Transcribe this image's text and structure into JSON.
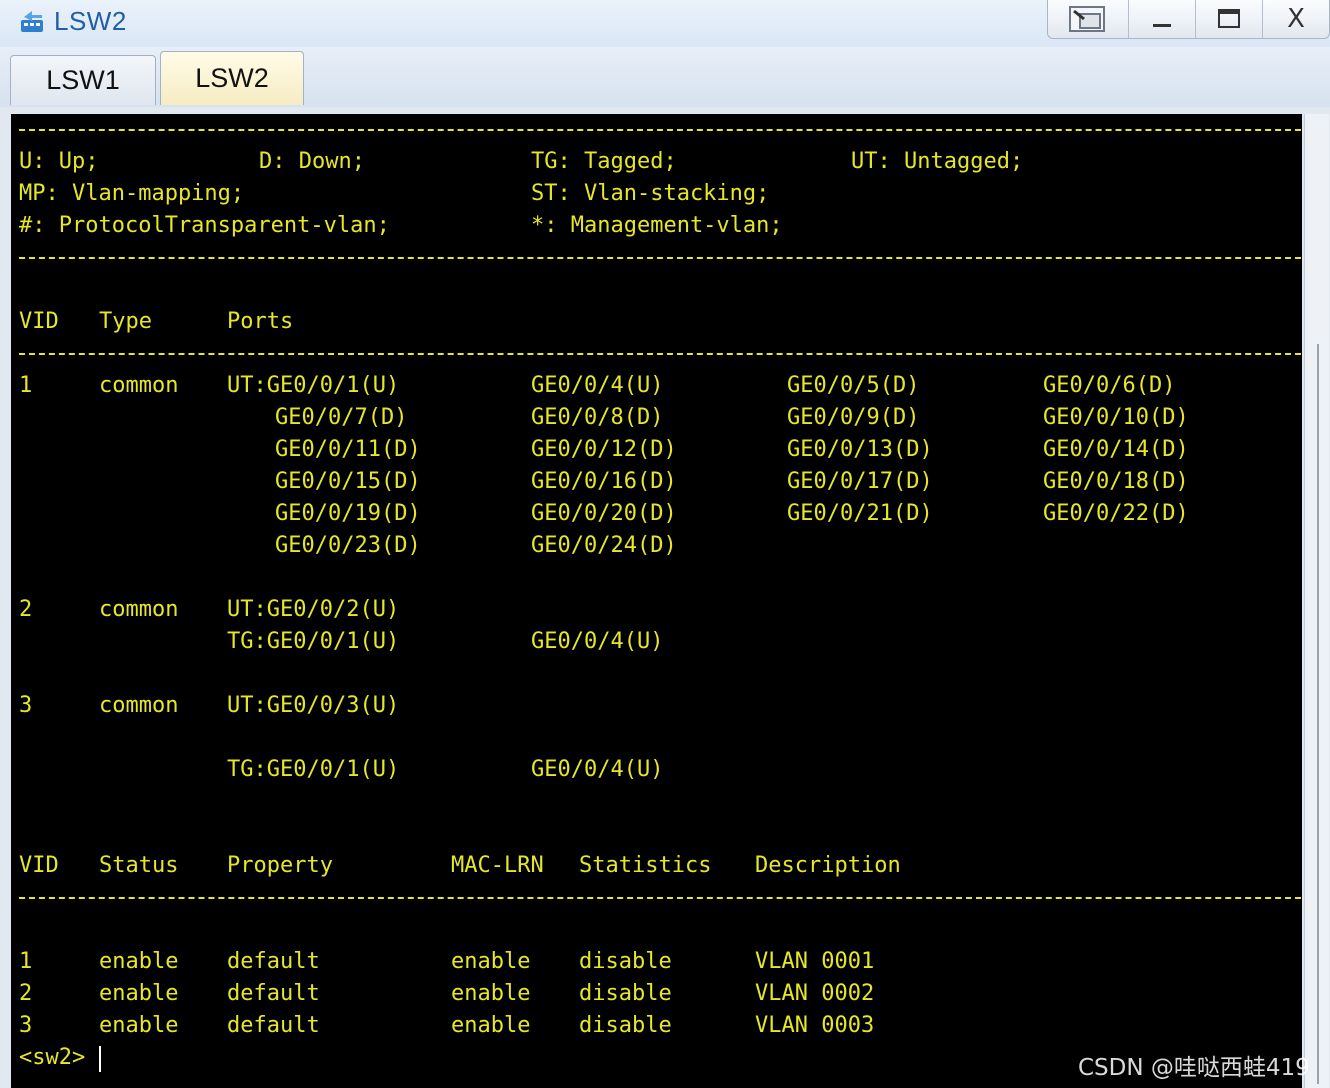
{
  "window": {
    "title": "LSW2",
    "icon": "switch-icon",
    "controls": [
      "restore-tab-icon",
      "minimize-icon",
      "maximize-icon",
      "close-icon"
    ],
    "close_glyph": "X"
  },
  "tabs": [
    {
      "label": "LSW1",
      "active": false
    },
    {
      "label": "LSW2",
      "active": true
    }
  ],
  "terminal": {
    "legend": {
      "up": "U: Up;",
      "down": "D: Down;",
      "tagged": "TG: Tagged;",
      "untagged": "UT: Untagged;",
      "mapping": "MP: Vlan-mapping;",
      "stacking": "ST: Vlan-stacking;",
      "transparent": "#: ProtocolTransparent-vlan;",
      "mgmt": "*: Management-vlan;"
    },
    "vlan_header": {
      "vid": "VID",
      "type": "Type",
      "ports": "Ports"
    },
    "vlan1": {
      "vid": "1",
      "type": "common",
      "rows": [
        [
          "UT:GE0/0/1(U)",
          "GE0/0/4(U)",
          "GE0/0/5(D)",
          "GE0/0/6(D)"
        ],
        [
          "GE0/0/7(D)",
          "GE0/0/8(D)",
          "GE0/0/9(D)",
          "GE0/0/10(D)"
        ],
        [
          "GE0/0/11(D)",
          "GE0/0/12(D)",
          "GE0/0/13(D)",
          "GE0/0/14(D)"
        ],
        [
          "GE0/0/15(D)",
          "GE0/0/16(D)",
          "GE0/0/17(D)",
          "GE0/0/18(D)"
        ],
        [
          "GE0/0/19(D)",
          "GE0/0/20(D)",
          "GE0/0/21(D)",
          "GE0/0/22(D)"
        ],
        [
          "GE0/0/23(D)",
          "GE0/0/24(D)"
        ]
      ]
    },
    "vlan2": {
      "vid": "2",
      "type": "common",
      "ut": "UT:GE0/0/2(U)",
      "tg": [
        "TG:GE0/0/1(U)",
        "GE0/0/4(U)"
      ]
    },
    "vlan3": {
      "vid": "3",
      "type": "common",
      "ut": "UT:GE0/0/3(U)",
      "tg": [
        "TG:GE0/0/1(U)",
        "GE0/0/4(U)"
      ]
    },
    "status_header": {
      "vid": "VID",
      "status": "Status",
      "property": "Property",
      "mac_lrn": "MAC-LRN",
      "statistics": "Statistics",
      "description": "Description"
    },
    "status_rows": [
      {
        "vid": "1",
        "status": "enable",
        "property": "default",
        "mac_lrn": "enable",
        "statistics": "disable",
        "description": "VLAN 0001"
      },
      {
        "vid": "2",
        "status": "enable",
        "property": "default",
        "mac_lrn": "enable",
        "statistics": "disable",
        "description": "VLAN 0002"
      },
      {
        "vid": "3",
        "status": "enable",
        "property": "default",
        "mac_lrn": "enable",
        "statistics": "disable",
        "description": "VLAN 0003"
      }
    ],
    "prompt": "<sw2>"
  },
  "watermark": "CSDN @哇哒西蛙419",
  "colors": {
    "terminal_bg": "#000000",
    "terminal_text": "#e6e62a",
    "title_text": "#1f5fa8"
  }
}
